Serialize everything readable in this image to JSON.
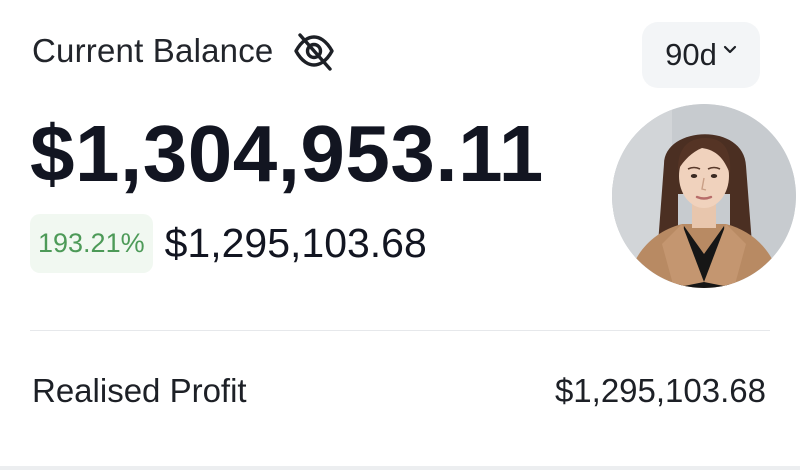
{
  "balance_card": {
    "title": "Current Balance",
    "visibility_icon": "eye-off-icon",
    "range": {
      "selected": "90d",
      "icon": "chevron-down-icon"
    },
    "balance": "$1,304,953.11",
    "change_percent": "193.21%",
    "change_amount": "$1,295,103.68",
    "avatar": "profile-photo",
    "realised_profit": {
      "label": "Realised Profit",
      "value": "$1,295,103.68"
    }
  },
  "colors": {
    "positive": "#4d9a58",
    "positive_bg": "#f1f8f1",
    "range_bg": "#f3f5f7",
    "text": "#121521"
  }
}
